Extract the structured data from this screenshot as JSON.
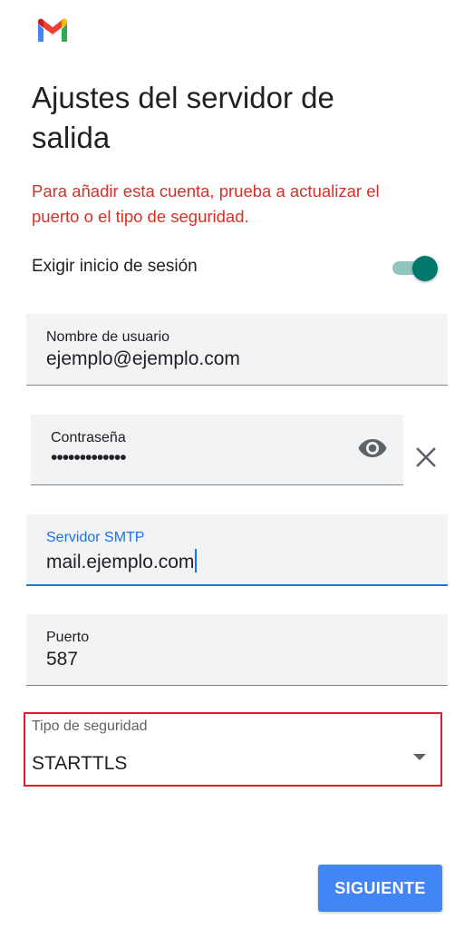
{
  "header": {
    "logo_icon": "gmail-logo",
    "title_line1": "Ajustes del servidor de",
    "title_line2": "salida"
  },
  "error_message": "Para añadir esta cuenta, prueba a actualizar el puerto o el tipo de seguridad.",
  "require_login": {
    "label": "Exigir inicio de sesión",
    "enabled": true,
    "accent_color": "#00796b"
  },
  "fields": {
    "username": {
      "label": "Nombre de usuario",
      "value": "ejemplo@ejemplo.com"
    },
    "password": {
      "label": "Contraseña",
      "value": "•••••••••••••",
      "show_icon": "eye-icon",
      "clear_icon": "close-icon"
    },
    "smtp": {
      "label": "Servidor SMTP",
      "value": "mail.ejemplo.com",
      "focused": true,
      "focus_color": "#1a73e8"
    },
    "port": {
      "label": "Puerto",
      "value": "587"
    }
  },
  "security": {
    "label": "Tipo de seguridad",
    "value": "STARTTLS",
    "highlight_color": "#e21b2c"
  },
  "actions": {
    "next_label": "SIGUIENTE",
    "button_color": "#4285f4"
  },
  "colors": {
    "error": "#d93025"
  }
}
